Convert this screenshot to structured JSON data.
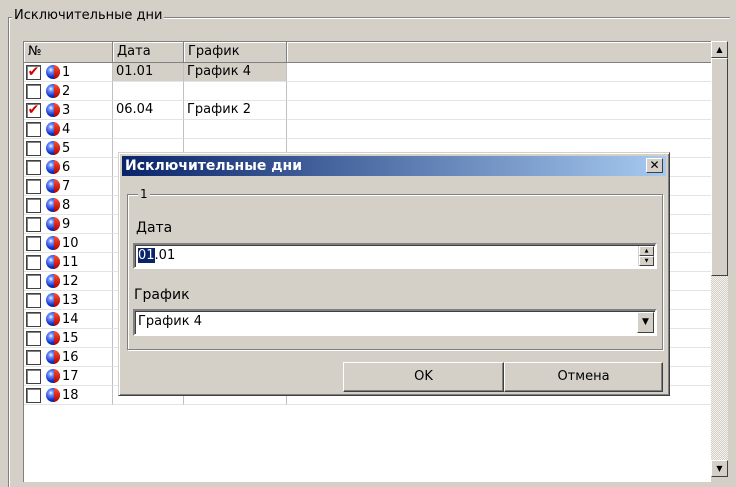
{
  "group": {
    "title": "Исключительные дни"
  },
  "grid": {
    "columns": [
      "№",
      "Дата",
      "График"
    ],
    "rows": [
      {
        "checked": true,
        "num": "1",
        "date": "01.01",
        "schedule": "График 4"
      },
      {
        "checked": false,
        "num": "2",
        "date": "",
        "schedule": ""
      },
      {
        "checked": true,
        "num": "3",
        "date": "06.04",
        "schedule": "График 2"
      },
      {
        "checked": false,
        "num": "4",
        "date": "",
        "schedule": ""
      },
      {
        "checked": false,
        "num": "5",
        "date": "",
        "schedule": ""
      },
      {
        "checked": false,
        "num": "6",
        "date": "",
        "schedule": ""
      },
      {
        "checked": false,
        "num": "7",
        "date": "",
        "schedule": ""
      },
      {
        "checked": false,
        "num": "8",
        "date": "",
        "schedule": ""
      },
      {
        "checked": false,
        "num": "9",
        "date": "",
        "schedule": ""
      },
      {
        "checked": false,
        "num": "10",
        "date": "",
        "schedule": ""
      },
      {
        "checked": false,
        "num": "11",
        "date": "",
        "schedule": ""
      },
      {
        "checked": false,
        "num": "12",
        "date": "",
        "schedule": ""
      },
      {
        "checked": false,
        "num": "13",
        "date": "",
        "schedule": ""
      },
      {
        "checked": false,
        "num": "14",
        "date": "",
        "schedule": ""
      },
      {
        "checked": false,
        "num": "15",
        "date": "",
        "schedule": ""
      },
      {
        "checked": false,
        "num": "16",
        "date": "",
        "schedule": ""
      },
      {
        "checked": false,
        "num": "17",
        "date": "",
        "schedule": ""
      },
      {
        "checked": false,
        "num": "18",
        "date": "",
        "schedule": ""
      }
    ]
  },
  "dialog": {
    "title": "Исключительные дни",
    "close_glyph": "✕",
    "group_title": "1",
    "date_label": "Дата",
    "date_selected": "01",
    "date_rest": ".01",
    "schedule_label": "График",
    "schedule_value": "График 4",
    "ok_label": "OK",
    "cancel_label": "Отмена"
  },
  "icons": {
    "checkmark": "✔",
    "row_icon": "ball-icon"
  }
}
